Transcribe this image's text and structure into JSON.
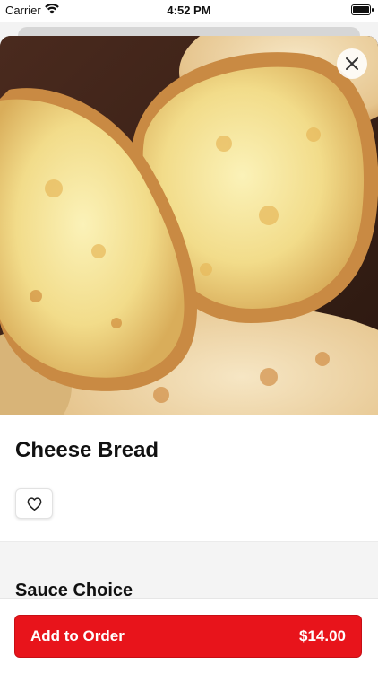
{
  "status_bar": {
    "carrier": "Carrier",
    "time": "4:52 PM"
  },
  "hero": {
    "image_icon": "cheese-bread-photo"
  },
  "product": {
    "title": "Cheese Bread",
    "favorite_icon": "heart-outline-icon"
  },
  "sections": [
    {
      "title": "Sauce Choice"
    }
  ],
  "cta": {
    "label": "Add to Order",
    "price": "$14.00",
    "color": "#e8141b"
  }
}
